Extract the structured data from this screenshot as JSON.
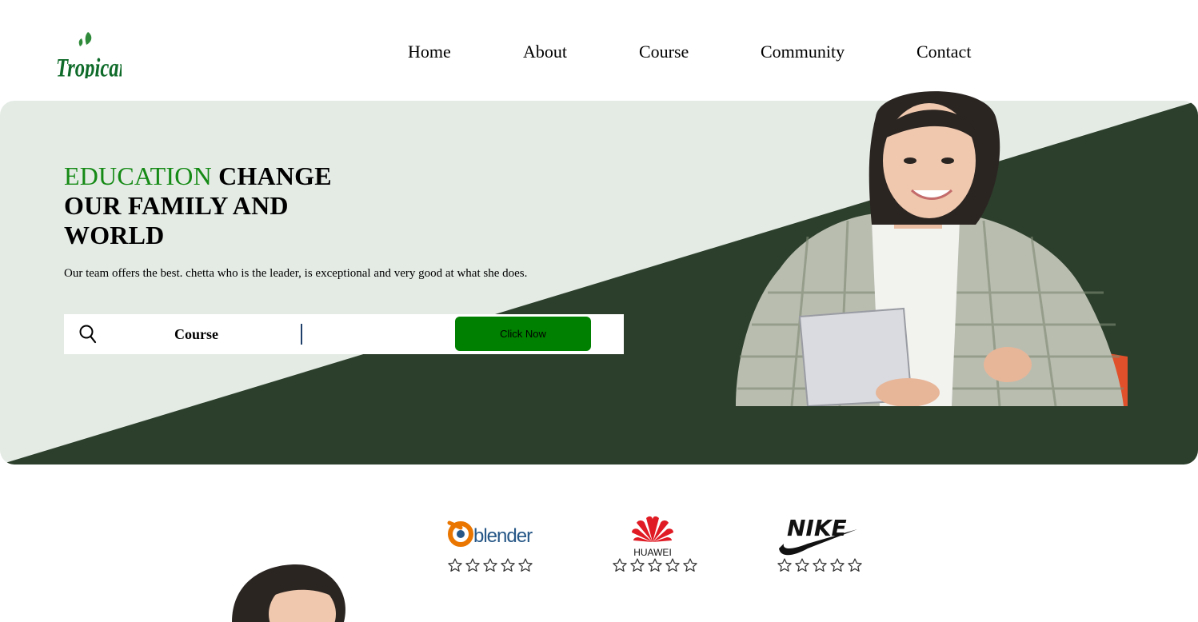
{
  "brand": {
    "logo_text": "Tropicana"
  },
  "nav": {
    "items": [
      "Home",
      "About",
      "Course",
      "Community",
      "Contact"
    ]
  },
  "hero": {
    "headline_accent": "EDUCATION",
    "headline_line1_rest": "CHANGE",
    "headline_line2": "OUR FAMILY AND",
    "headline_line3": "WORLD",
    "subtext": "Our team offers the best. chetta who is the leader, is exceptional and very good at what she does.",
    "search": {
      "category": "Course",
      "placeholder": "",
      "button_label": "Click Now"
    }
  },
  "partners": [
    {
      "name": "blender",
      "rating": 0,
      "max": 5
    },
    {
      "name": "HUAWEI",
      "rating": 0,
      "max": 5
    },
    {
      "name": "NIKE",
      "rating": 0,
      "max": 5
    }
  ],
  "colors": {
    "accent_green": "#158a15",
    "dark_green": "#2c3f2c",
    "light_bg": "#e4ebe5",
    "cta_green": "#008000"
  }
}
